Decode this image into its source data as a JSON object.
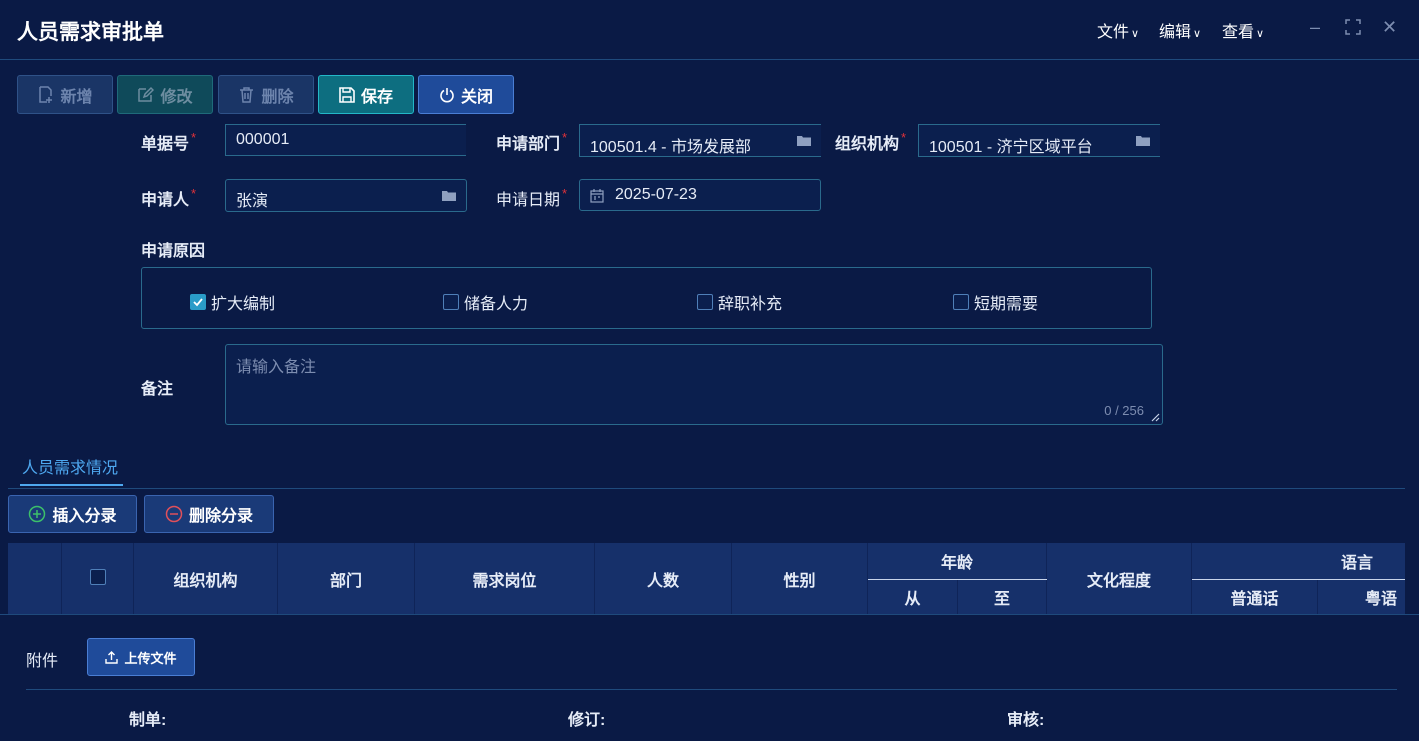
{
  "window": {
    "title": "人员需求审批单",
    "menus": [
      "文件",
      "编辑",
      "查看"
    ]
  },
  "toolbar": {
    "add": "新增",
    "edit": "修改",
    "delete": "删除",
    "save": "保存",
    "close": "关闭"
  },
  "form": {
    "doc_no_label": "单据号",
    "doc_no": "000001",
    "dept_label": "申请部门",
    "dept": "100501.4 - 市场发展部",
    "org_label": "组织机构",
    "org": "100501 - 济宁区域平台",
    "applicant_label": "申请人",
    "applicant": "张演",
    "date_label": "申请日期",
    "date": "2025-07-23",
    "reason_label": "申请原因",
    "reasons": [
      {
        "label": "扩大编制",
        "checked": true
      },
      {
        "label": "储备人力",
        "checked": false
      },
      {
        "label": "辞职补充",
        "checked": false
      },
      {
        "label": "短期需要",
        "checked": false
      }
    ],
    "remark_label": "备注",
    "remark_placeholder": "请输入备注",
    "remark_counter": "0 / 256"
  },
  "detail": {
    "tab_label": "人员需求情况",
    "insert_btn": "插入分录",
    "delete_btn": "删除分录",
    "headers": {
      "org": "组织机构",
      "dept": "部门",
      "position": "需求岗位",
      "count": "人数",
      "gender": "性别",
      "age": "年龄",
      "age_from": "从",
      "age_to": "至",
      "education": "文化程度",
      "language": "语言",
      "mandarin": "普通话",
      "cantonese": "粤语"
    }
  },
  "attachments": {
    "label": "附件",
    "upload_btn": "上传文件"
  },
  "footer": {
    "maker": "制单:",
    "revise": "修订:",
    "audit": "审核:"
  },
  "colors": {
    "background": "#0a1a45",
    "accent": "#4ea8f0",
    "save_button": "#0d6e80",
    "required": "#e0323a"
  }
}
